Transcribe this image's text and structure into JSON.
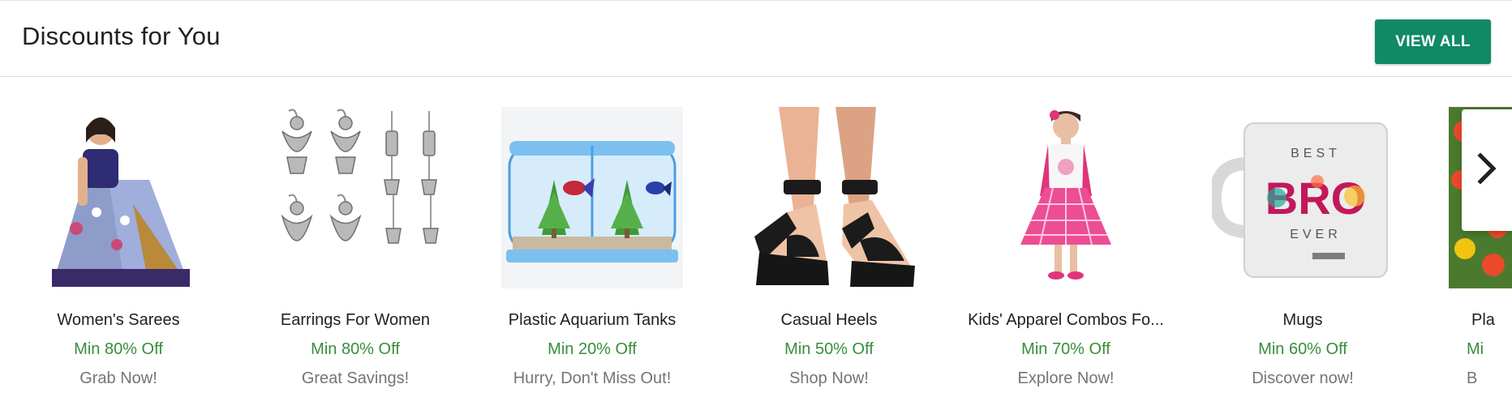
{
  "section": {
    "title": "Discounts for You",
    "view_all_label": "VIEW ALL",
    "accent_color": "#108a64",
    "discount_color": "#388e3c"
  },
  "items": [
    {
      "name": "Women's Sarees",
      "discount": "Min 80% Off",
      "tagline": "Grab Now!",
      "image": "saree-image"
    },
    {
      "name": "Earrings For Women",
      "discount": "Min 80% Off",
      "tagline": "Great Savings!",
      "image": "earrings-image"
    },
    {
      "name": "Plastic Aquarium Tanks",
      "discount": "Min 20% Off",
      "tagline": "Hurry, Don't Miss Out!",
      "image": "aquarium-image"
    },
    {
      "name": "Casual Heels",
      "discount": "Min 50% Off",
      "tagline": "Shop Now!",
      "image": "heels-image"
    },
    {
      "name": "Kids' Apparel Combos Fo...",
      "discount": "Min 70% Off",
      "tagline": "Explore Now!",
      "image": "kids-apparel-image"
    },
    {
      "name": "Mugs",
      "discount": "Min 60% Off",
      "tagline": "Discover now!",
      "image": "mug-image",
      "mug_text_top": "BEST",
      "mug_text_main": "BRO",
      "mug_text_bottom": "EVER"
    },
    {
      "name": "Pla",
      "discount": "Mi",
      "tagline": "B",
      "image": "plants-image"
    }
  ],
  "carousel": {
    "next_icon": "chevron-right-icon"
  }
}
